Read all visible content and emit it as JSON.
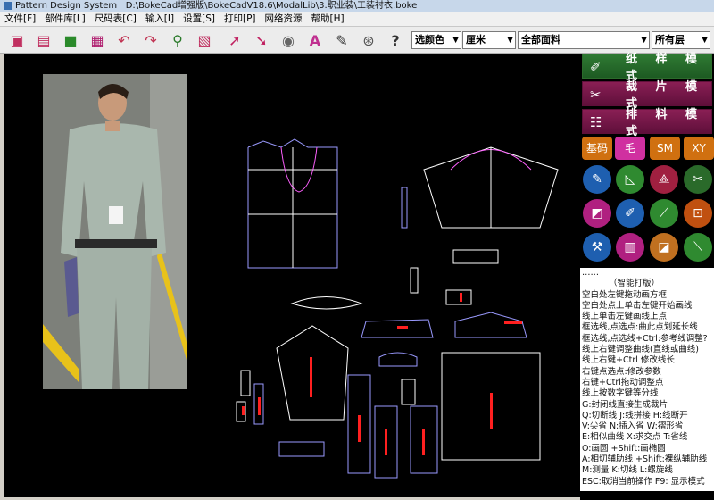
{
  "window": {
    "app_name": "Pattern Design System",
    "path": "D:\\BokeCad增强版\\BokeCadV18.6\\ModalLib\\3.职业装\\工装衬衣.boke"
  },
  "menu": [
    "文件[F]",
    "部件库[L]",
    "尺码表[C]",
    "输入[I]",
    "设置[S]",
    "打印[P]",
    "网络资源",
    "帮助[H]"
  ],
  "toolbar": {
    "color_select": "选颜色",
    "unit_select": "厘米",
    "fabric_select": "全部面料",
    "layer_select": "所有层",
    "help_symbol": "?"
  },
  "modes": {
    "paper": "纸 样 模 式",
    "cut": "裁 片 模 式",
    "layout": "排 料 模 式"
  },
  "tags": [
    "基码",
    "毛",
    "SM",
    "XY"
  ],
  "help": {
    "partial_line": "……",
    "title": "（智能打版）",
    "lines": [
      "空白处左键拖动画方框",
      "空白处点上单击左键开始画线",
      "线上单击左键画线上点",
      "框选线,点选点:曲此点划延长线",
      "框选线,点选线+Ctrl:参考线调整?",
      "线上右键调整曲线(直线或曲线)",
      "线上右键+Ctrl 修改线长",
      "右键点选点:修改参数",
      "右键+Ctrl拖动调整点",
      "线上按数字键等分线",
      "G:封闭线直接生成裁片",
      "Q:切断线 J:线拼接 H:线断开",
      "V:尖省 N:插入省 W:褶形省",
      "E:相似曲线 X:求交点 T:省线",
      "O:画圆 +Shift:画椭圆",
      "A:相切辅助线 +Shift:裸纵辅助线",
      "M:测量 K:切线 L:螺旋线",
      "ESC:取消当前操作  F9: 显示模式"
    ]
  }
}
